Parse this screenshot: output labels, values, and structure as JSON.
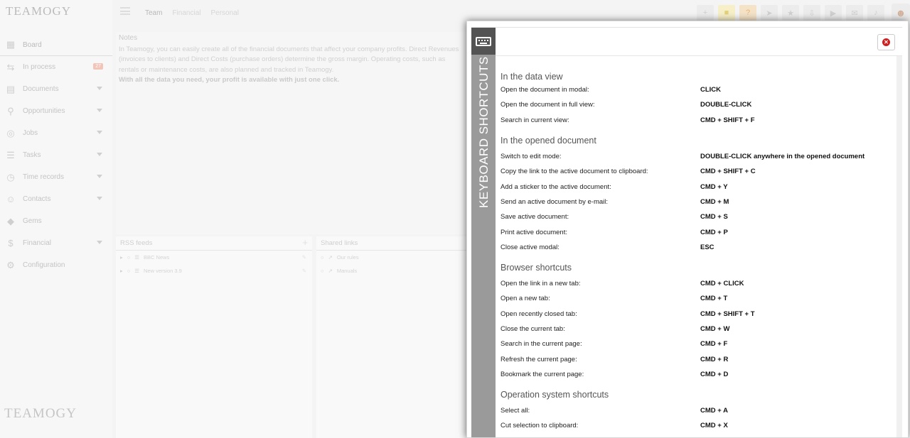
{
  "app": {
    "logo": "TEAMOGY",
    "logo_bottom": "TEAMOGY"
  },
  "sidebar": {
    "items": [
      {
        "label": "Board",
        "icon": "board-icon",
        "glyph": "▦",
        "has_caret": false,
        "badge": ""
      },
      {
        "label": "In process",
        "icon": "process-icon",
        "glyph": "⇆",
        "has_caret": false,
        "badge": "27"
      },
      {
        "label": "Documents",
        "icon": "document-icon",
        "glyph": "▤",
        "has_caret": true,
        "badge": ""
      },
      {
        "label": "Opportunities",
        "icon": "filter-icon",
        "glyph": "⚲",
        "has_caret": true,
        "badge": ""
      },
      {
        "label": "Jobs",
        "icon": "target-icon",
        "glyph": "◎",
        "has_caret": true,
        "badge": ""
      },
      {
        "label": "Tasks",
        "icon": "tasks-icon",
        "glyph": "☰",
        "has_caret": true,
        "badge": ""
      },
      {
        "label": "Time records",
        "icon": "clock-icon",
        "glyph": "◷",
        "has_caret": true,
        "badge": ""
      },
      {
        "label": "Contacts",
        "icon": "contact-icon",
        "glyph": "☺",
        "has_caret": true,
        "badge": ""
      },
      {
        "label": "Gems",
        "icon": "gem-icon",
        "glyph": "◆",
        "has_caret": false,
        "badge": ""
      },
      {
        "label": "Financial",
        "icon": "dollar-icon",
        "glyph": "$",
        "has_caret": true,
        "badge": ""
      },
      {
        "label": "Configuration",
        "icon": "gear-icon",
        "glyph": "⚙",
        "has_caret": false,
        "badge": ""
      }
    ]
  },
  "topbar": {
    "tabs": [
      "Team",
      "Financial",
      "Personal"
    ],
    "active_tab": "Team",
    "icons": [
      {
        "name": "add-icon",
        "glyph": "+",
        "style": ""
      },
      {
        "name": "sticker-icon",
        "glyph": "■",
        "style": "yellow"
      },
      {
        "name": "help-icon",
        "glyph": "?",
        "style": "orange"
      },
      {
        "name": "send-icon",
        "glyph": "➤",
        "style": ""
      },
      {
        "name": "star-icon",
        "glyph": "★",
        "style": ""
      },
      {
        "name": "inbox-icon",
        "glyph": "⇩",
        "style": ""
      },
      {
        "name": "video-icon",
        "glyph": "▶",
        "style": ""
      },
      {
        "name": "chat-icon",
        "glyph": "✉",
        "style": ""
      },
      {
        "name": "bell-icon",
        "glyph": "♪",
        "style": ""
      }
    ]
  },
  "notes": {
    "title": "Notes",
    "text": "In Teamogy, you can easily create all of the financial documents that affect your company profits. Direct Revenues (invoices to clients) and Direct Costs (purchase orders) determine the gross margin. Operating costs, such as rentals or maintenance costs, are also planned and tracked in Teamogy.",
    "bold_text": "With all the data you need, your profit is available with just one click."
  },
  "rss": {
    "title": "RSS feeds",
    "items": [
      "BBC News",
      "New version 3.9"
    ]
  },
  "shared_links": {
    "title": "Shared links",
    "items": [
      "Our rules",
      "Manuals"
    ]
  },
  "modal": {
    "vertical_title": "KEYBOARD SHORTCUTS",
    "sections": [
      {
        "title": "In the data view",
        "rows": [
          {
            "label": "Open the document in modal:",
            "key": "CLICK"
          },
          {
            "label": "Open the document in full view:",
            "key": "DOUBLE-CLICK"
          },
          {
            "label": "Search in current view:",
            "key": "CMD + SHIFT + F"
          }
        ]
      },
      {
        "title": "In the opened document",
        "rows": [
          {
            "label": "Switch to edit mode:",
            "key": "DOUBLE-CLICK anywhere in the opened document"
          },
          {
            "label": "Copy the link to the active document to clipboard:",
            "key": "CMD + SHIFT + C"
          },
          {
            "label": "Add a sticker to the active document:",
            "key": "CMD + Y"
          },
          {
            "label": "Send an active document by e-mail:",
            "key": "CMD + M"
          },
          {
            "label": "Save active document:",
            "key": "CMD + S"
          },
          {
            "label": "Print active document:",
            "key": "CMD + P"
          },
          {
            "label": "Close active modal:",
            "key": "ESC"
          }
        ]
      },
      {
        "title": "Browser shortcuts",
        "rows": [
          {
            "label": "Open the link in a new tab:",
            "key": "CMD + CLICK"
          },
          {
            "label": "Open a new tab:",
            "key": "CMD + T"
          },
          {
            "label": "Open recently closed tab:",
            "key": "CMD + SHIFT + T"
          },
          {
            "label": "Close the current tab:",
            "key": "CMD + W"
          },
          {
            "label": "Search in the current page:",
            "key": "CMD + F"
          },
          {
            "label": "Refresh the current page:",
            "key": "CMD + R"
          },
          {
            "label": "Bookmark the current page:",
            "key": "CMD + D"
          }
        ]
      },
      {
        "title": "Operation system shortcuts",
        "rows": [
          {
            "label": "Select all:",
            "key": "CMD + A"
          },
          {
            "label": "Cut selection to clipboard:",
            "key": "CMD + X"
          }
        ]
      }
    ]
  }
}
